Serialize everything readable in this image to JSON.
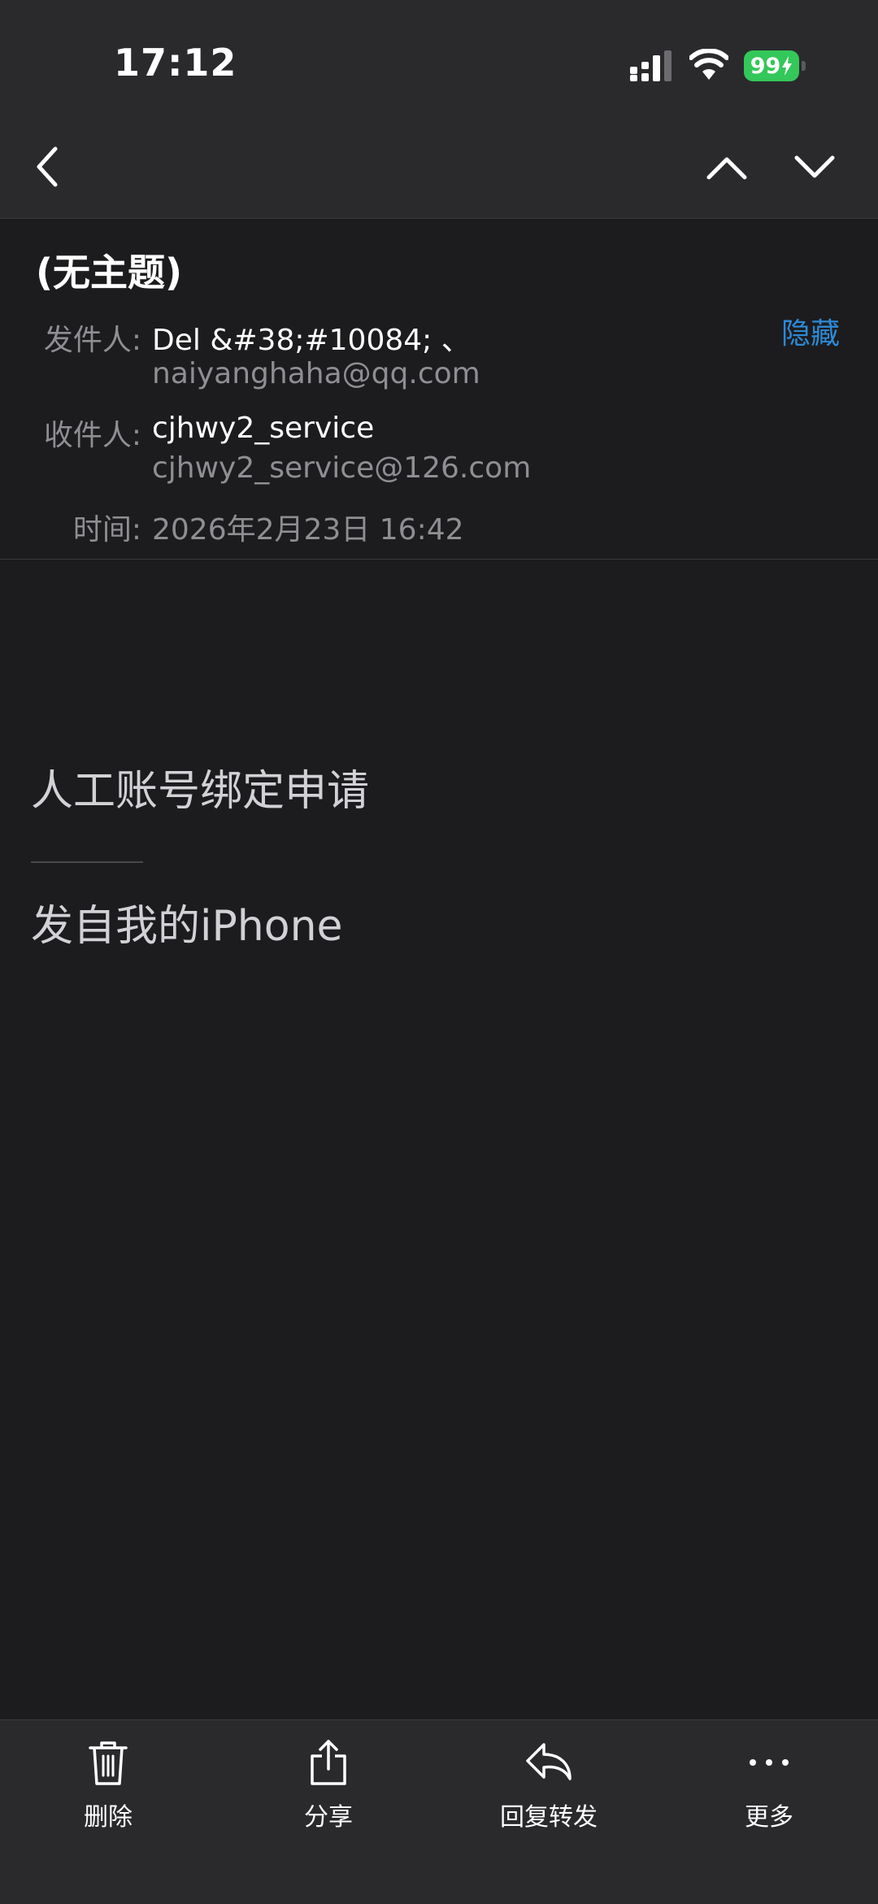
{
  "status_bar": {
    "time": "17:12",
    "battery": "99",
    "icons": [
      "signal-icon",
      "wifi-icon",
      "battery-charging-icon"
    ]
  },
  "nav": {
    "icons": [
      "chevron-left-icon",
      "chevron-up-icon",
      "chevron-down-icon"
    ]
  },
  "email": {
    "subject": "(无主题)",
    "from_label": "发件人:",
    "from_name": "Del &#38;#10084; 、",
    "from_email": "naiyanghaha@qq.com",
    "to_label": "收件人:",
    "to_name": "cjhwy2_service",
    "to_email": "cjhwy2_service@126.com",
    "time_label": "时间:",
    "time_value": "2026年2月23日 16:42",
    "hide_label": "隐藏"
  },
  "body": {
    "line1": "人工账号绑定申请",
    "signature": "发自我的iPhone"
  },
  "toolbar": {
    "delete_label": "删除",
    "share_label": "分享",
    "reply_label": "回复转发",
    "more_label": "更多"
  },
  "colors": {
    "background": "#1c1c1e",
    "bar": "#2a2a2d",
    "accent": "#2d8ad6",
    "battery": "#34c759",
    "secondary_text": "#8e8e93"
  }
}
